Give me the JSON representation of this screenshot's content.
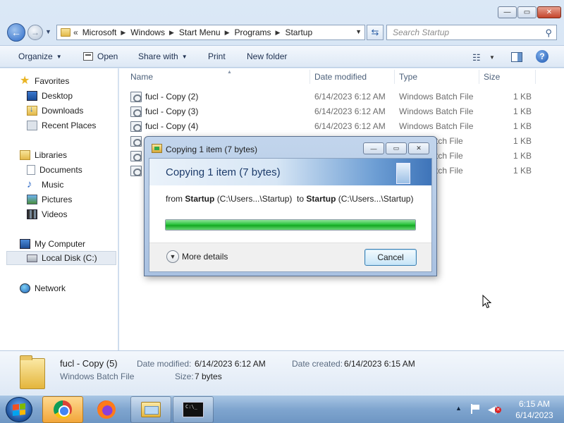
{
  "window": {
    "caption": {
      "minimize": "—",
      "maximize": "▭",
      "close": "✕"
    }
  },
  "address": {
    "chevron": "«",
    "breadcrumbs": [
      "Microsoft",
      "Windows",
      "Start Menu",
      "Programs",
      "Startup"
    ],
    "search_placeholder": "Search Startup"
  },
  "toolbar": {
    "organize": "Organize",
    "open": "Open",
    "share_with": "Share with",
    "print": "Print",
    "new_folder": "New folder"
  },
  "navpane": {
    "favorites": "Favorites",
    "desktop": "Desktop",
    "downloads": "Downloads",
    "recent_places": "Recent Places",
    "libraries": "Libraries",
    "documents": "Documents",
    "music": "Music",
    "pictures": "Pictures",
    "videos": "Videos",
    "my_computer": "My Computer",
    "local_disk": "Local Disk (C:)",
    "network": "Network"
  },
  "filelist": {
    "columns": {
      "name": "Name",
      "date": "Date modified",
      "type": "Type",
      "size": "Size"
    },
    "rows": [
      {
        "name": "fucl - Copy (2)",
        "date": "6/14/2023 6:12 AM",
        "type": "Windows Batch File",
        "size": "1 KB"
      },
      {
        "name": "fucl - Copy (3)",
        "date": "6/14/2023 6:12 AM",
        "type": "Windows Batch File",
        "size": "1 KB"
      },
      {
        "name": "fucl - Copy (4)",
        "date": "6/14/2023 6:12 AM",
        "type": "Windows Batch File",
        "size": "1 KB"
      },
      {
        "name": "",
        "date": "",
        "type": "tch File",
        "size": "1 KB"
      },
      {
        "name": "",
        "date": "",
        "type": "tch File",
        "size": "1 KB"
      },
      {
        "name": "",
        "date": "",
        "type": "tch File",
        "size": "1 KB"
      }
    ]
  },
  "details": {
    "name": "fucl - Copy (5)",
    "type": "Windows Batch File",
    "date_modified_label": "Date modified:",
    "date_modified": "6/14/2023 6:12 AM",
    "date_created_label": "Date created:",
    "date_created": "6/14/2023 6:15 AM",
    "size_label": "Size:",
    "size": "7 bytes"
  },
  "dialog": {
    "title": "Copying 1 item (7 bytes)",
    "heading": "Copying 1 item (7 bytes)",
    "from_word": "from",
    "from_name": "Startup",
    "from_path": "(C:\\Users...\\Startup)",
    "to_word": "to",
    "to_name": "Startup",
    "to_path": "(C:\\Users...\\Startup)",
    "progress": 1.0,
    "more_details": "More details",
    "cancel": "Cancel",
    "caption": {
      "minimize": "—",
      "maximize": "▭",
      "close": "✕"
    }
  },
  "taskbar": {
    "clock_time": "6:15 AM",
    "clock_date": "6/14/2023",
    "cmd_text": "C:\\_"
  }
}
